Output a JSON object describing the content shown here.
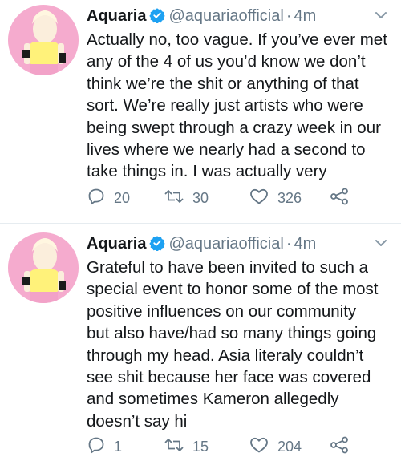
{
  "tweets": [
    {
      "name": "Aquaria",
      "handle": "@aquariaofficial",
      "separator": "·",
      "time": "4m",
      "lines": [
        "Actually no, too vague. If you’ve ever met",
        "any of the 4 of us you’d know we don’t",
        "think we’re the shit or anything of that",
        "sort. We’re really just artists who were",
        "being swept through a crazy week in our",
        "lives where we nearly had a second to",
        "take things in. I was actually very"
      ],
      "replies": "20",
      "retweets": "30",
      "likes": "326"
    },
    {
      "name": "Aquaria",
      "handle": "@aquariaofficial",
      "separator": "·",
      "time": "4m",
      "lines": [
        "Grateful to have been invited to such a",
        "special event to honor some of the most",
        "positive influences on our community",
        "but also have/had so many things going",
        "through my head. Asia literaly couldn’t",
        "see shit because her face was covered",
        "and sometimes Kameron allegedly",
        "doesn’t say hi"
      ],
      "replies": "1",
      "retweets": "15",
      "likes": "204"
    }
  ],
  "colors": {
    "text": "#14171a",
    "muted": "#657786",
    "verified": "#1da1f2",
    "avatar_background": "#f7b4d4",
    "divider": "#e6ecf0"
  },
  "icons": [
    "verified-badge-icon",
    "chevron-down-icon",
    "reply-icon",
    "retweet-icon",
    "like-icon",
    "share-icon"
  ]
}
